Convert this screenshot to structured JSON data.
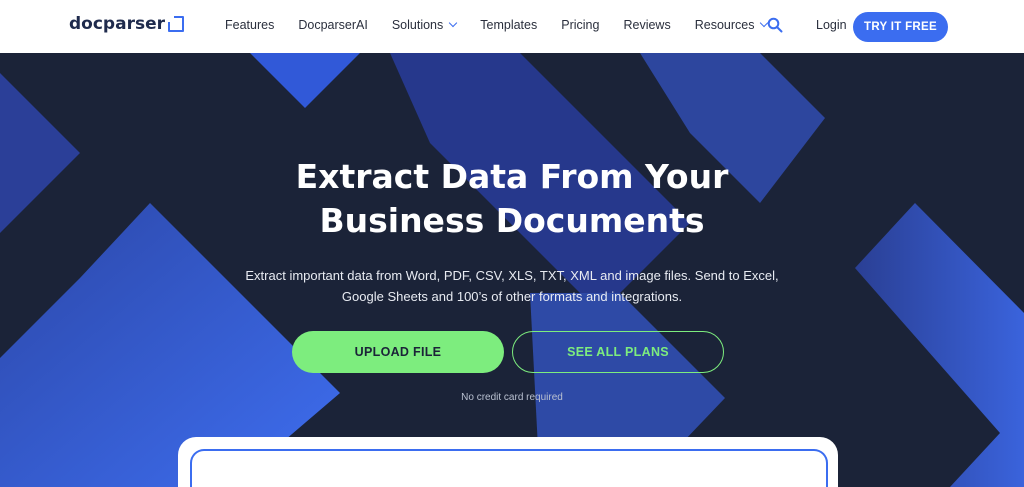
{
  "nav": {
    "logo_text": "docparser",
    "items": [
      "Features",
      "DocparserAI",
      "Solutions",
      "Templates",
      "Pricing",
      "Reviews",
      "Resources"
    ],
    "login": "Login",
    "cta": "TRY IT FREE"
  },
  "hero": {
    "title_line1": "Extract Data From Your",
    "title_line2": "Business Documents",
    "sub_line1": "Extract important data from Word, PDF, CSV, XLS, TXT, XML and image files. Send to Excel,",
    "sub_line2": "Google Sheets and 100’s of other formats and integrations.",
    "upload": "UPLOAD FILE",
    "plans": "SEE ALL PLANS",
    "note": "No credit card required"
  },
  "colors": {
    "accent": "#3b6df0",
    "green": "#7ded7e",
    "dark": "#1b2338"
  }
}
